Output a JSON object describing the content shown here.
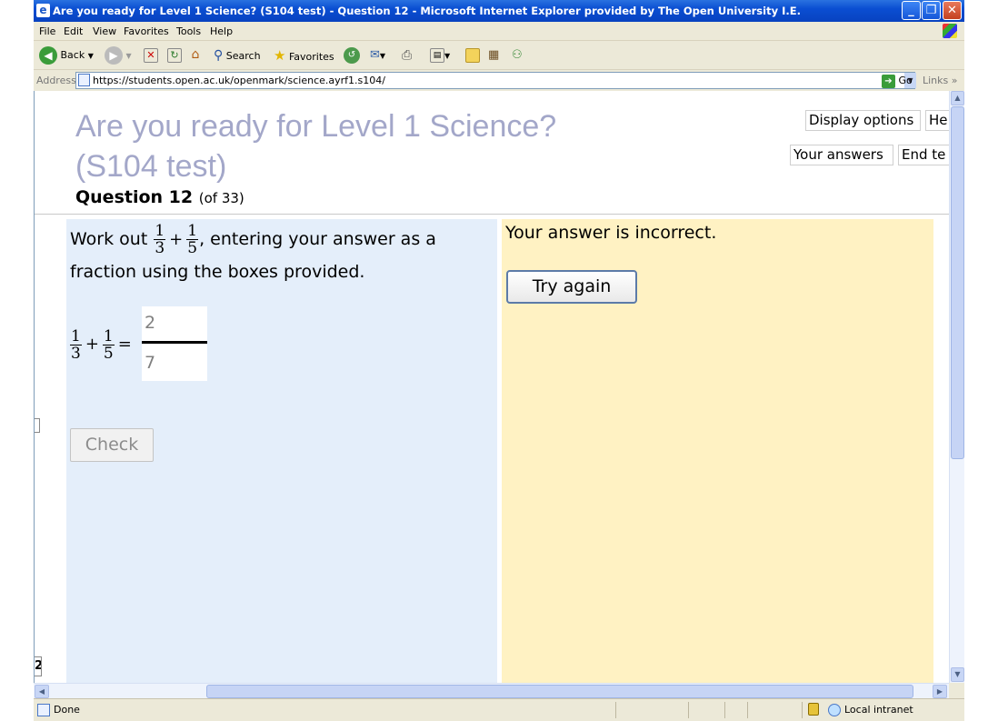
{
  "window": {
    "title": "Are you ready for Level 1 Science? (S104 test) - Question 12 - Microsoft Internet Explorer provided by The Open University I.E.",
    "controls": {
      "minimize": "_",
      "maximize": "❐",
      "close": "✕"
    }
  },
  "menu": [
    "File",
    "Edit",
    "View",
    "Favorites",
    "Tools",
    "Help"
  ],
  "toolbar": {
    "back": "Back",
    "search": "Search",
    "favorites": "Favorites"
  },
  "address": {
    "label": "Address",
    "url": "https://students.open.ac.uk/openmark/science.ayrf1.s104/",
    "go": "Go",
    "links": "Links"
  },
  "page": {
    "title_line1": "Are you ready for Level 1 Science?",
    "title_line2": "(S104 test)",
    "question_label": "Question 12",
    "question_count": "(of 33)",
    "buttons": {
      "display_options": "Display options",
      "help": "He",
      "your_answers": "Your answers",
      "end_test": "End te"
    },
    "question": {
      "prefix": "Work out",
      "frac1": {
        "num": "1",
        "den": "3"
      },
      "plus": "+",
      "frac2": {
        "num": "1",
        "den": "5"
      },
      "suffix": ", entering your answer as a fraction using the boxes provided.",
      "equals": "=",
      "answer_numerator": "2",
      "answer_denominator": "7",
      "check": "Check"
    },
    "feedback": {
      "message": "Your answer is incorrect.",
      "try_again": "Try again"
    },
    "left_fragment": "2"
  },
  "status": {
    "done": "Done",
    "zone": "Local intranet"
  },
  "colors": {
    "question_panel": "#e4eefa",
    "feedback_panel": "#fff2c3",
    "title_text": "#a3a7c9",
    "titlebar": "#0a4ed2"
  }
}
